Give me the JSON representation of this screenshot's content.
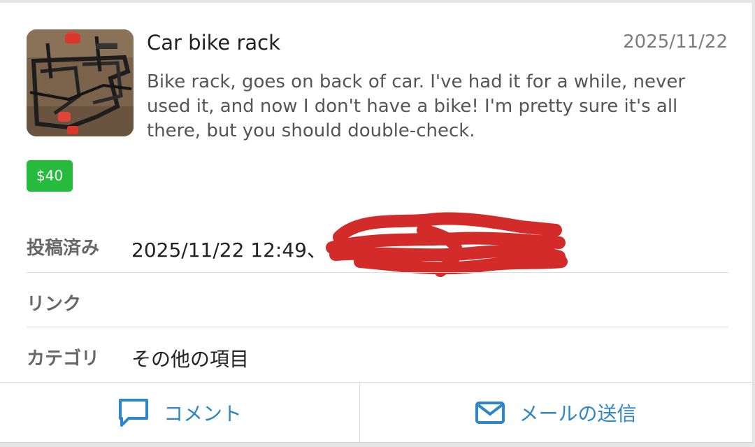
{
  "listing": {
    "title": "Car bike rack",
    "date": "2025/11/22",
    "description": "Bike rack, goes on back of car. I've had it for a while, never used it, and now I don't have a bike! I'm pretty sure it's all there, but you should double-check.",
    "price": "$40",
    "thumbnail_icon": "bike-rack-photo"
  },
  "details": {
    "posted_label": "投稿済み",
    "posted_value": "2025/11/22 12:49、",
    "link_label": "リンク",
    "link_value": "",
    "category_label": "カテゴリ",
    "category_value": "その他の項目"
  },
  "actions": {
    "comment_label": "コメント",
    "comment_icon": "comment-icon",
    "email_label": "メールの送信",
    "email_icon": "mail-icon"
  },
  "colors": {
    "accent": "#2e86c8",
    "price_badge": "#26bb3c",
    "redaction": "#d32a2a"
  }
}
